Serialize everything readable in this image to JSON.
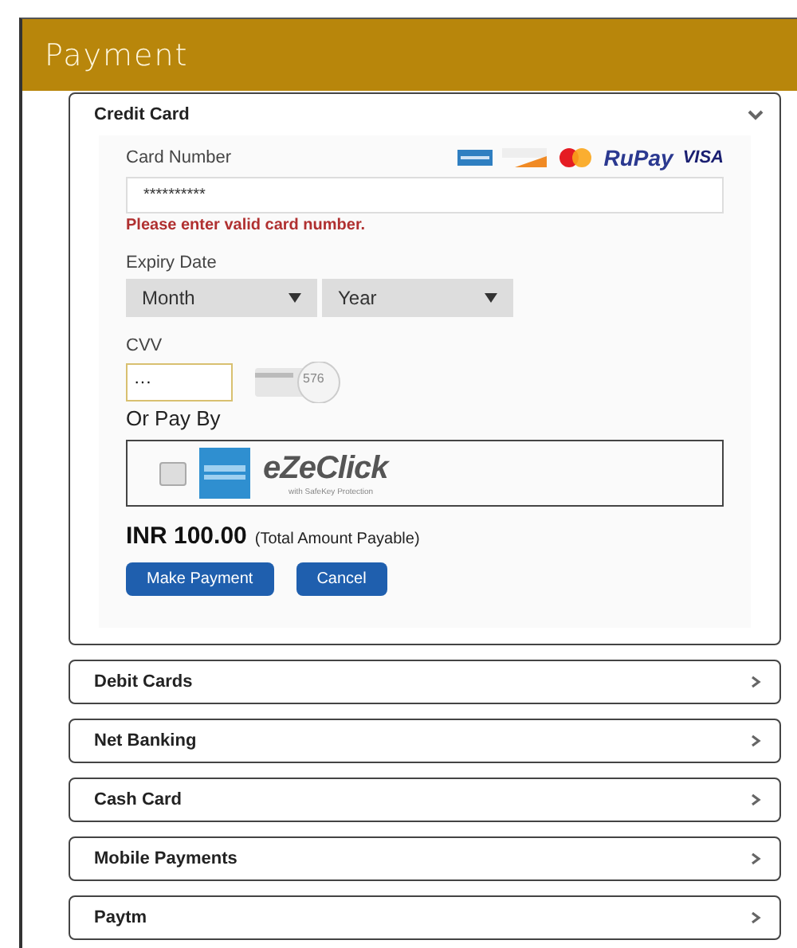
{
  "header": {
    "title": "Payment"
  },
  "panels": [
    {
      "title": "Credit Card",
      "expanded": true
    },
    {
      "title": "Debit Cards",
      "expanded": false
    },
    {
      "title": "Net Banking",
      "expanded": false
    },
    {
      "title": "Cash Card",
      "expanded": false
    },
    {
      "title": "Mobile Payments",
      "expanded": false
    },
    {
      "title": "Paytm",
      "expanded": false
    }
  ],
  "credit_card": {
    "card_number": {
      "label": "Card Number",
      "value": "**********",
      "error": "Please enter valid card number."
    },
    "card_logos": [
      {
        "kind": "amex"
      },
      {
        "kind": "discover"
      },
      {
        "kind": "mastercard"
      },
      {
        "kind": "rupay",
        "text": "RuPay"
      },
      {
        "kind": "visa",
        "text": "VISA"
      }
    ],
    "expiry": {
      "label": "Expiry Date",
      "month": "Month",
      "year": "Year"
    },
    "cvv": {
      "label": "CVV",
      "value": "···",
      "hint_number": "576"
    },
    "or_pay_by": "Or Pay By",
    "ezeclick": {
      "checked": false,
      "name": "eZeClick",
      "tagline": "with SafeKey Protection"
    },
    "amount": "INR 100.00",
    "amount_note": "(Total Amount Payable)",
    "buttons": [
      "Make Payment",
      "Cancel"
    ]
  }
}
